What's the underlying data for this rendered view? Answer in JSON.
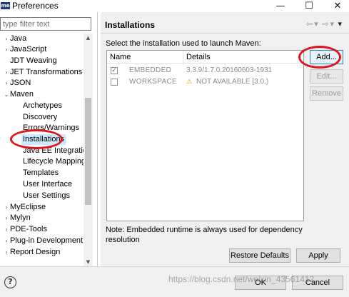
{
  "window": {
    "app_badge": "me",
    "title": "Preferences",
    "minimize_glyph": "—",
    "maximize_glyph": "☐",
    "close_glyph": "✕"
  },
  "sidebar": {
    "filter_placeholder": "type filter text",
    "items": [
      {
        "arrow": "›",
        "label": "Java"
      },
      {
        "arrow": "›",
        "label": "JavaScript"
      },
      {
        "arrow": "",
        "label": "JDT Weaving"
      },
      {
        "arrow": "›",
        "label": "JET Transformations"
      },
      {
        "arrow": "›",
        "label": "JSON"
      },
      {
        "arrow": "⌄",
        "label": "Maven"
      },
      {
        "arrow": "",
        "label": "Archetypes"
      },
      {
        "arrow": "",
        "label": "Discovery"
      },
      {
        "arrow": "",
        "label": "Errors/Warnings"
      },
      {
        "arrow": "",
        "label": "Installations"
      },
      {
        "arrow": "",
        "label": "Java EE Integration"
      },
      {
        "arrow": "",
        "label": "Lifecycle Mapping"
      },
      {
        "arrow": "",
        "label": "Templates"
      },
      {
        "arrow": "",
        "label": "User Interface"
      },
      {
        "arrow": "",
        "label": "User Settings"
      },
      {
        "arrow": "›",
        "label": "MyEclipse"
      },
      {
        "arrow": "›",
        "label": "Mylyn"
      },
      {
        "arrow": "›",
        "label": "PDE-Tools"
      },
      {
        "arrow": "›",
        "label": "Plug-in Development"
      },
      {
        "arrow": "›",
        "label": "Report Design"
      }
    ]
  },
  "page": {
    "title": "Installations",
    "nav": {
      "back": "⇦",
      "back_menu": "▾",
      "forward": "⇨",
      "forward_menu": "▾",
      "menu": "▾"
    },
    "instruction": "Select the installation used to launch Maven:",
    "table": {
      "columns": [
        "Name",
        "Details"
      ],
      "rows": [
        {
          "checked": true,
          "check_glyph": "✓",
          "name": "EMBEDDED",
          "details": "3.3.9/1.7.0.20160603-1931",
          "warning": false
        },
        {
          "checked": false,
          "check_glyph": "",
          "name": "WORKSPACE",
          "details": "NOT AVAILABLE [3.0,)",
          "warning": true,
          "warning_glyph": "⚠"
        }
      ]
    },
    "buttons": {
      "add": "Add...",
      "edit": "Edit...",
      "remove": "Remove"
    },
    "note": "Note: Embedded runtime is always used for dependency resolution",
    "restore_defaults": "Restore Defaults",
    "apply": "Apply"
  },
  "footer": {
    "help_glyph": "?",
    "ok": "OK",
    "cancel": "Cancel",
    "watermark": "https://blog.csdn.net/weixin_43561412"
  },
  "colors": {
    "highlight_circle": "#e0141b",
    "selection": "#cde8ff",
    "default_button_border": "#3c7fb1"
  }
}
